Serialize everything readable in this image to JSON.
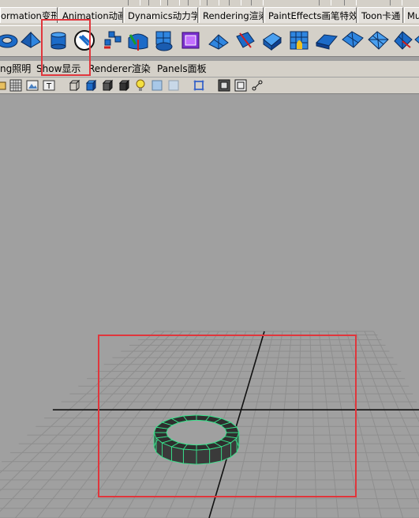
{
  "shelf_tabs": [
    "ormation变形",
    "Animation动画",
    "Dynamics动力学",
    "Rendering渲染",
    "PaintEffects画笔特效",
    "Toon卡通",
    "Mu"
  ],
  "shelf_icons": [
    "poly-torus-icon",
    "poly-pyramid-icon",
    "poly-cylinder-icon",
    "circle-tool-icon",
    "poly-extract-icon",
    "poly-split-icon",
    "poly-separate-icon",
    "poly-combine-icon",
    "smooth-cube-icon",
    "poly-plane-icon",
    "poly-bevel-icon",
    "extrude-face-icon",
    "poly-grid-icon",
    "wedge-face-icon",
    "poly-sheet-icon",
    "split-polygon-icon",
    "poly-fold-icon"
  ],
  "panel_menu": [
    "ng照明",
    "Show显示",
    "Renderer渲染",
    "Panels面板"
  ],
  "panel_toolbar_icons": [
    "camera-icon",
    "grid-icon",
    "image-plane-icon",
    "texture-icon",
    "wireframe-cube-icon",
    "smooth-shaded-cube-icon",
    "flat-shaded-cube-icon",
    "textured-cube-icon",
    "lights-bulb-icon",
    "default-lighting-icon",
    "xray-icon",
    "isolate-select-icon",
    "resolution-gate-icon",
    "safe-frame-icon",
    "field-chart-icon"
  ],
  "colors": {
    "highlight": "#e0363c",
    "torus_wire": "#38e08a",
    "viewport_bg": "#a0a0a0",
    "grid_line": "#8e8e8e",
    "axis_line": "#111111"
  }
}
